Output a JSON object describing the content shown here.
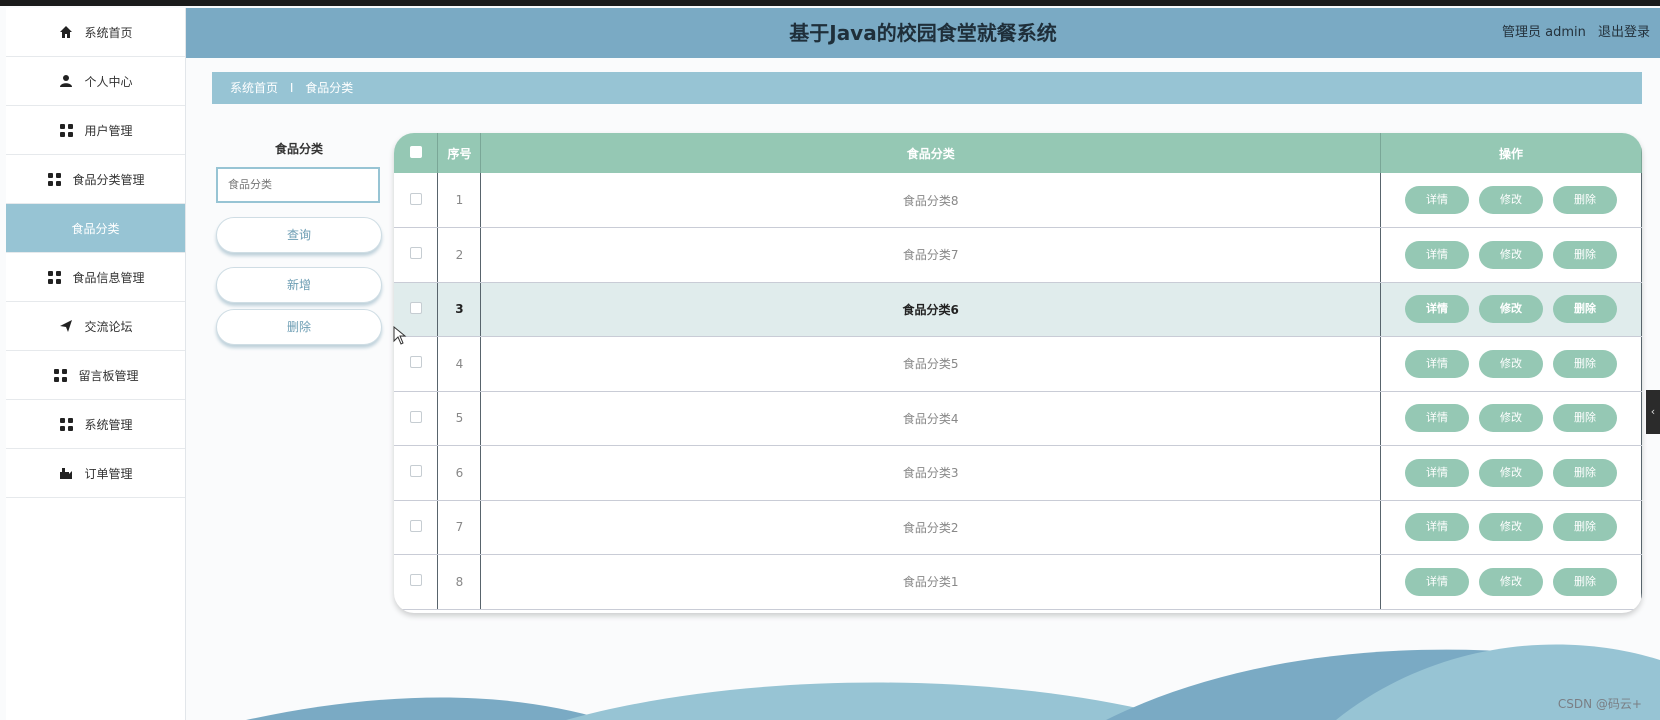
{
  "app": {
    "title": "基于Java的校园食堂就餐系统"
  },
  "header": {
    "user_label": "管理员 admin",
    "logout": "退出登录"
  },
  "sidebar": {
    "items": [
      {
        "label": "系统首页",
        "icon": "home-icon"
      },
      {
        "label": "个人中心",
        "icon": "user-icon"
      },
      {
        "label": "用户管理",
        "icon": "grid-icon"
      },
      {
        "label": "食品分类管理",
        "icon": "grid-icon"
      },
      {
        "label": "食品分类",
        "icon": "",
        "active": true
      },
      {
        "label": "食品信息管理",
        "icon": "grid-icon"
      },
      {
        "label": "交流论坛",
        "icon": "send-icon"
      },
      {
        "label": "留言板管理",
        "icon": "grid-icon"
      },
      {
        "label": "系统管理",
        "icon": "grid-icon"
      },
      {
        "label": "订单管理",
        "icon": "cart-icon"
      }
    ]
  },
  "breadcrumb": {
    "home": "系统首页",
    "current": "食品分类",
    "separator": "I"
  },
  "search": {
    "label": "食品分类",
    "placeholder": "食品分类",
    "query": "查询",
    "add": "新增",
    "delete": "删除"
  },
  "table": {
    "headers": [
      "序号",
      "食品分类",
      "操作"
    ],
    "rows": [
      {
        "no": "1",
        "name": "食品分类8"
      },
      {
        "no": "2",
        "name": "食品分类7"
      },
      {
        "no": "3",
        "name": "食品分类6"
      },
      {
        "no": "4",
        "name": "食品分类5"
      },
      {
        "no": "5",
        "name": "食品分类4"
      },
      {
        "no": "6",
        "name": "食品分类3"
      },
      {
        "no": "7",
        "name": "食品分类2"
      },
      {
        "no": "8",
        "name": "食品分类1"
      }
    ],
    "actions": {
      "detail": "详情",
      "edit": "修改",
      "delete": "删除"
    }
  },
  "colors": {
    "header": "#7aaac4",
    "accent": "#97c4d4",
    "table_head": "#95c8b4"
  },
  "watermark": "CSDN @码云+"
}
